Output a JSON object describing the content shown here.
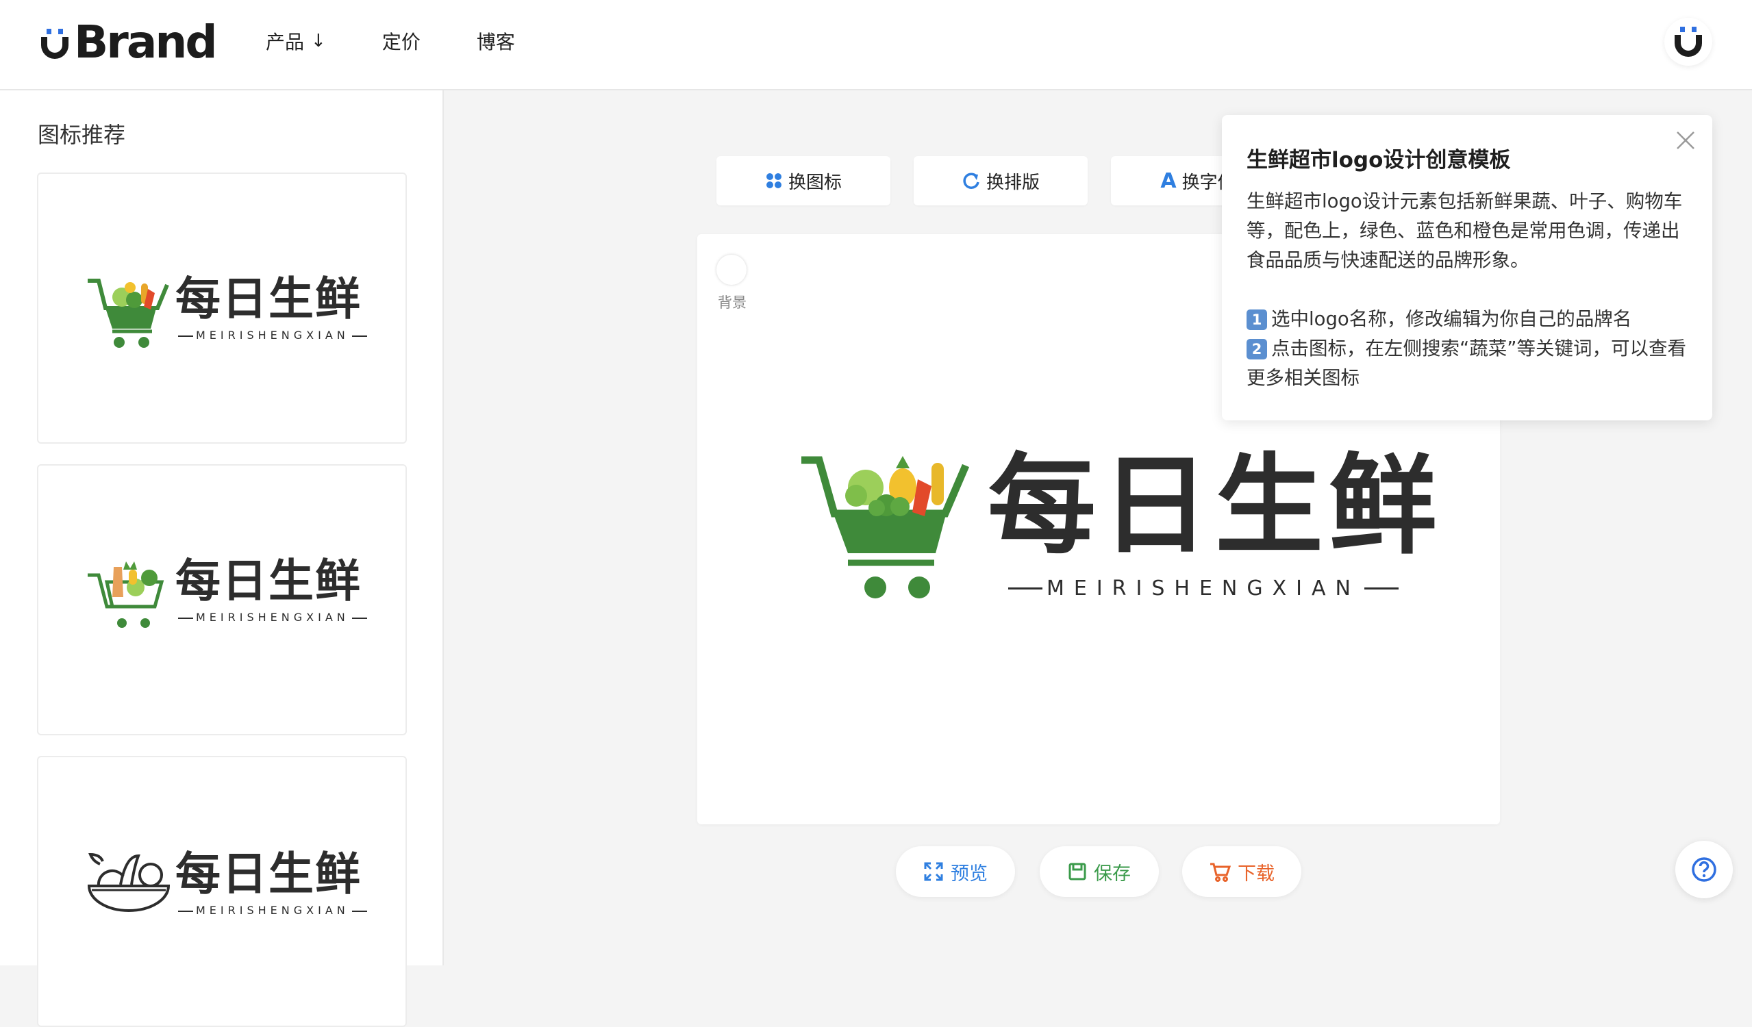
{
  "header": {
    "brand": "Brand",
    "nav": [
      {
        "label": "产品",
        "has_dropdown": true
      },
      {
        "label": "定价"
      },
      {
        "label": "博客"
      }
    ]
  },
  "sidebar": {
    "title": "图标推荐",
    "cards": [
      {
        "name_cn": "每日生鲜",
        "name_en": "MEIRISHENGXIAN",
        "icon": "shopping-cart-vegetables-icon"
      },
      {
        "name_cn": "每日生鲜",
        "name_en": "MEIRISHENGXIAN",
        "icon": "cart-produce-icon"
      },
      {
        "name_cn": "每日生鲜",
        "name_en": "MEIRISHENGXIAN",
        "icon": "fruit-bowl-outline-icon"
      }
    ]
  },
  "toolbar": {
    "change_icon": "换图标",
    "change_layout": "换排版",
    "change_font": "换字体"
  },
  "canvas": {
    "bg_label": "背景",
    "logo_cn": "每日生鲜",
    "logo_en": "MEIRISHENGXIAN"
  },
  "actions": {
    "preview": "预览",
    "save": "保存",
    "download": "下载"
  },
  "popup": {
    "title": "生鲜超市logo设计创意模板",
    "description": "生鲜超市logo设计元素包括新鲜果蔬、叶子、购物车等，配色上，绿色、蓝色和橙色是常用色调，传递出食品品质与快速配送的品牌形象。",
    "step1_num": "1",
    "step1": "选中logo名称，修改编辑为你自己的品牌名",
    "step2_num": "2",
    "step2": "点击图标，在左侧搜索“蔬菜”等关键词，可以查看更多相关图标"
  },
  "colors": {
    "brand_blue": "#2f6fe0",
    "logo_green": "#3f8a3a",
    "save_green": "#3a9a4a",
    "download_orange": "#e8632a",
    "preview_blue": "#2f7fe0"
  }
}
